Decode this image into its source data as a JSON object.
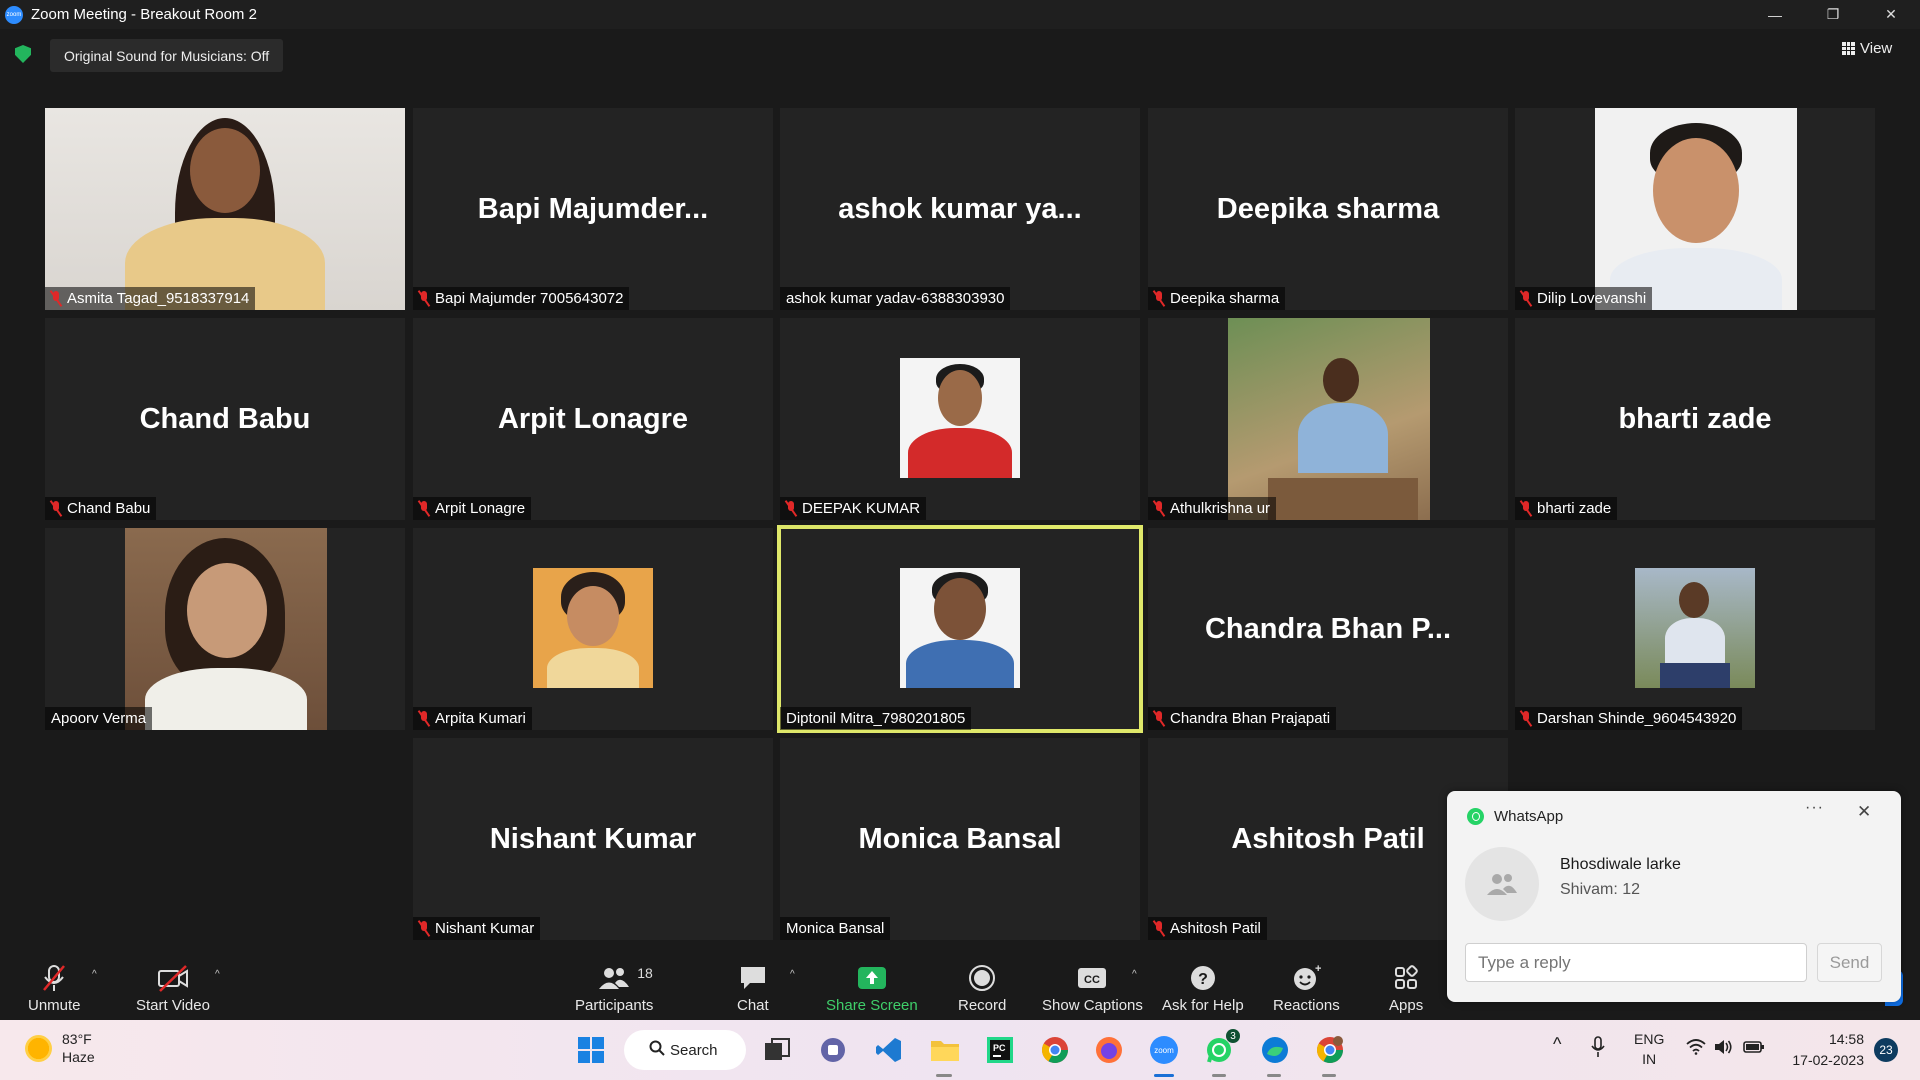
{
  "window": {
    "title": "Zoom Meeting - Breakout Room 2"
  },
  "info": {
    "original_sound": "Original Sound for Musicians: Off",
    "view_label": "View"
  },
  "tiles": [
    {
      "big": "",
      "label": "Asmita Tagad_9518337914",
      "muted": true
    },
    {
      "big": "Bapi  Majumder...",
      "label": "Bapi Majumder 7005643072",
      "muted": true
    },
    {
      "big": "ashok kumar ya...",
      "label": "ashok kumar yadav-6388303930",
      "muted": false
    },
    {
      "big": "Deepika sharma",
      "label": "Deepika sharma",
      "muted": true
    },
    {
      "big": "",
      "label": "Dilip Lovevanshi",
      "muted": true
    },
    {
      "big": "Chand Babu",
      "label": "Chand Babu",
      "muted": true
    },
    {
      "big": "Arpit Lonagre",
      "label": "Arpit Lonagre",
      "muted": true
    },
    {
      "big": "",
      "label": "DEEPAK KUMAR",
      "muted": true
    },
    {
      "big": "",
      "label": "Athulkrishna ur",
      "muted": true
    },
    {
      "big": "bharti zade",
      "label": "bharti zade",
      "muted": true
    },
    {
      "big": "",
      "label": "Apoorv Verma",
      "muted": false
    },
    {
      "big": "",
      "label": "Arpita Kumari",
      "muted": true
    },
    {
      "big": "",
      "label": "Diptonil Mitra_7980201805",
      "muted": false
    },
    {
      "big": "Chandra Bhan P...",
      "label": "Chandra Bhan Prajapati",
      "muted": true
    },
    {
      "big": "",
      "label": "Darshan Shinde_9604543920",
      "muted": true
    },
    {
      "big": "Nishant Kumar",
      "label": "Nishant Kumar",
      "muted": true
    },
    {
      "big": "Monica Bansal",
      "label": "Monica Bansal",
      "muted": false
    },
    {
      "big": "Ashitosh Patil",
      "label": "Ashitosh Patil",
      "muted": true
    }
  ],
  "toolbar": {
    "unmute": "Unmute",
    "start_video": "Start Video",
    "participants": "Participants",
    "participants_count": "18",
    "chat": "Chat",
    "share_screen": "Share Screen",
    "record": "Record",
    "show_captions": "Show Captions",
    "ask_help": "Ask for Help",
    "reactions": "Reactions",
    "apps": "Apps"
  },
  "whatsapp": {
    "app": "WhatsApp",
    "dots": "···",
    "close": "✕",
    "sender": "Bhosdiwale larke",
    "message": "Shivam: 12",
    "placeholder": "Type a reply",
    "send": "Send"
  },
  "taskbar": {
    "temp": "83°F",
    "condition": "Haze",
    "search": "Search",
    "lang1": "ENG",
    "lang2": "IN",
    "time": "14:58",
    "date": "17-02-2023",
    "notifications": "23",
    "whatsapp_badge": "3"
  },
  "colors": {
    "active_speaker": "#dfe86a",
    "muted_red": "#e02828",
    "share_green": "#3fcf6a",
    "zoom_blue": "#2d8cff"
  }
}
